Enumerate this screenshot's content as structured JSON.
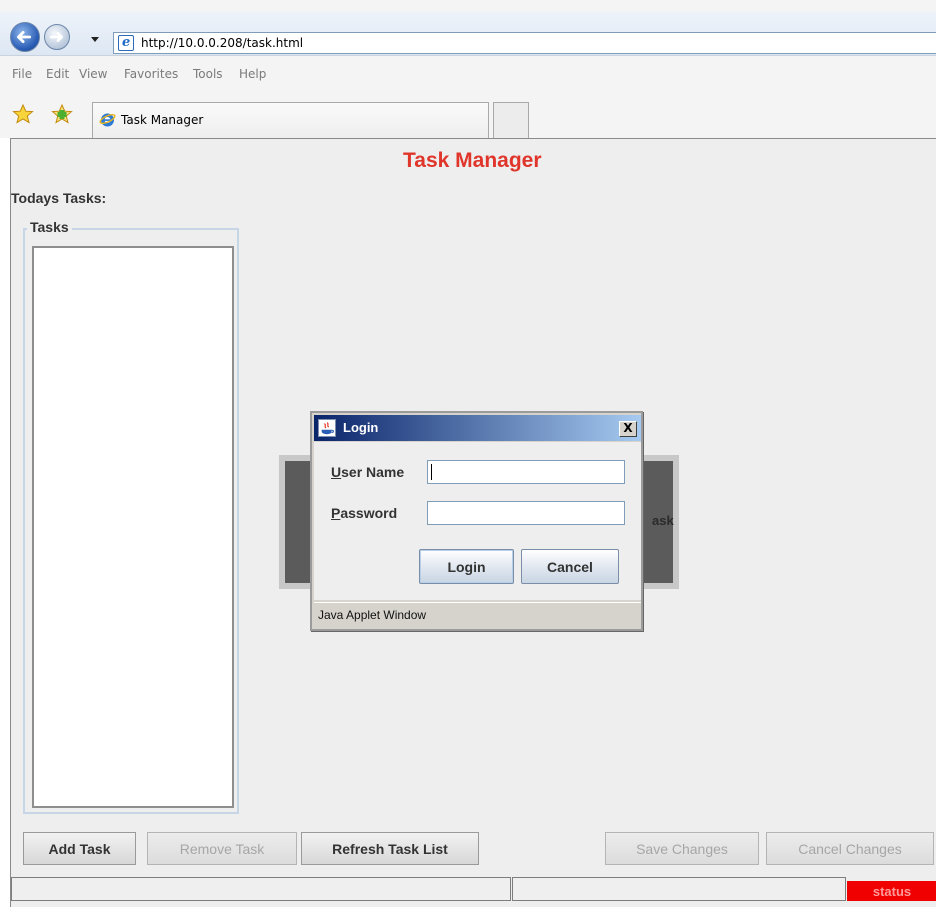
{
  "browser": {
    "address": "http://10.0.0.208/task.html",
    "menu": [
      "File",
      "Edit",
      "View",
      "Favorites",
      "Tools",
      "Help"
    ],
    "tab_title": "Task Manager"
  },
  "app": {
    "title": "Task Manager",
    "todays_tasks_label": "Todays Tasks:",
    "tasks_group_label": "Tasks",
    "background_partial_text": "ask",
    "buttons": {
      "add_task": "Add Task",
      "remove_task": "Remove Task",
      "refresh_task_list": "Refresh Task List",
      "save_changes": "Save Changes",
      "cancel_changes": "Cancel Changes"
    },
    "status": "status",
    "status_color": "#f00000",
    "title_color": "#e0352b"
  },
  "login_dialog": {
    "title": "Login",
    "close_glyph": "X",
    "username_label_first": "U",
    "username_label_rest": "ser Name",
    "password_label_first": "P",
    "password_label_rest": "assword",
    "username_value": "",
    "password_value": "",
    "login_button": "Login",
    "cancel_button": "Cancel",
    "warning": "Java Applet Window"
  }
}
